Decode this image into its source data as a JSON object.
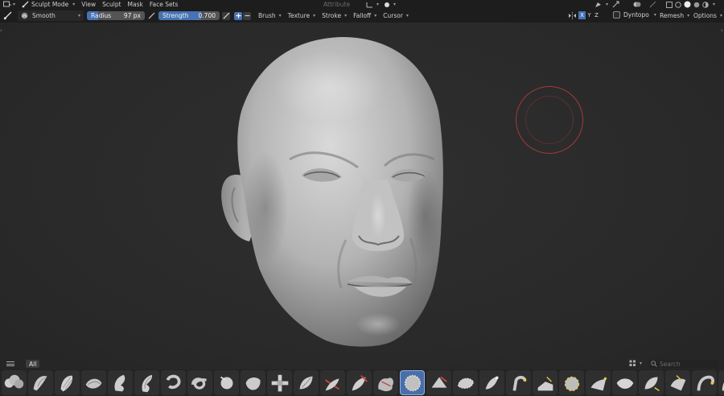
{
  "header": {
    "mode_label": "Sculpt Mode",
    "menus": [
      "View",
      "Sculpt",
      "Mask",
      "Face Sets"
    ],
    "attribute_label": "Attribute"
  },
  "tool_settings": {
    "brush_name": "Smooth",
    "radius_label": "Radius",
    "radius_value": "97 px",
    "strength_label": "Strength",
    "strength_value": "0.700",
    "strength_fraction": 0.7,
    "dropdowns": [
      "Brush",
      "Texture",
      "Stroke",
      "Falloff",
      "Cursor"
    ],
    "symmetry_axes": [
      "X",
      "Y",
      "Z"
    ],
    "active_axis": "X",
    "dyntopo_label": "Dyntopo",
    "remesh_label": "Remesh",
    "options_label": "Options"
  },
  "asset_shelf": {
    "tab_label": "All",
    "search_placeholder": "Search",
    "brush_count": 28,
    "active_index": 15
  },
  "colors": {
    "accent": "#4772b3",
    "cursor_ring": "#a33a3a",
    "background": "#1d1d1d"
  },
  "icons": [
    "brush-icon",
    "menu-icon",
    "search-icon",
    "grid-view-icon"
  ]
}
